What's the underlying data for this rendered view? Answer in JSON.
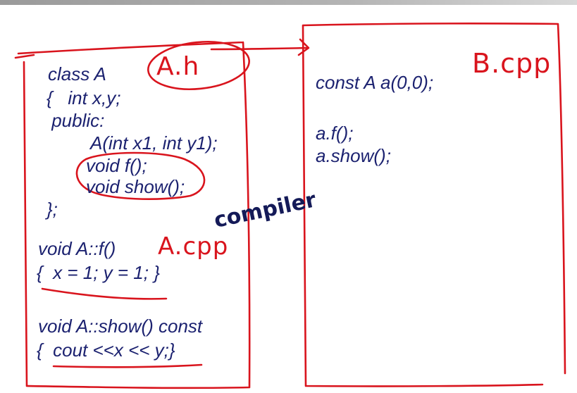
{
  "left_box": {
    "code_lines": [
      "class A",
      "{   int x,y;",
      " public:",
      "A(int x1, int y1);",
      "void f();",
      "void show();",
      "};",
      "void A::f()",
      "{  x = 1; y = 1; }",
      "void A::show() const",
      "{  cout <<x << y;}"
    ]
  },
  "right_box": {
    "code_lines": [
      "const A a(0,0);",
      "a.f();",
      "a.show();"
    ]
  },
  "annotations": {
    "header_file_label": "A.h",
    "source_file_label": "A.cpp",
    "target_file_label": "B.cpp",
    "compiler_label": "compiler"
  },
  "colors": {
    "code_text": "#1c2270",
    "pen_ink": "#d9141d",
    "compiler_text": "#141a58",
    "background": "#ffffff"
  }
}
